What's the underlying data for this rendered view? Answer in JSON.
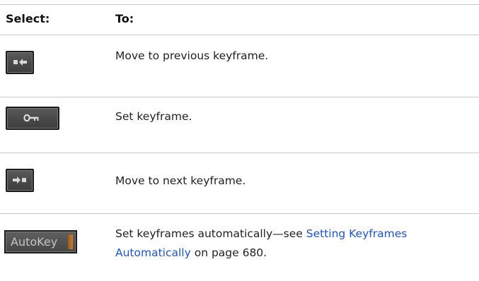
{
  "table": {
    "header": {
      "select": "Select:",
      "to": "To:"
    },
    "rows": [
      {
        "icon": "previous-keyframe-icon",
        "text": "Move to previous keyframe."
      },
      {
        "icon": "set-keyframe-key-icon",
        "text": "Set keyframe."
      },
      {
        "icon": "next-keyframe-icon",
        "text": "Move to next keyframe."
      },
      {
        "icon": "autokey-button",
        "button_label": "AutoKey",
        "text_before": "Set keyframes automatically—see ",
        "link_text": "Setting Keyframes Automatically",
        "text_after": " on page 680."
      }
    ]
  },
  "colors": {
    "link": "#1a55d8",
    "button_bg": "#4a4a4a",
    "icon_fg": "#d8d8d8",
    "autokey_accent": "#c97b32",
    "rule": "#c8c8c8"
  }
}
